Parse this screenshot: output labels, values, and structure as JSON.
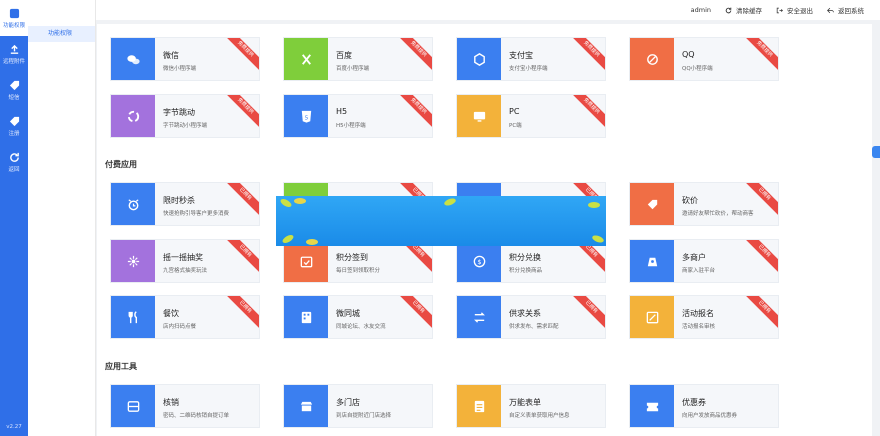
{
  "nav": {
    "items": [
      {
        "label": "功能权限",
        "icon": "grid-icon",
        "active": true
      },
      {
        "label": "远程附件",
        "icon": "upload-icon",
        "active": false
      },
      {
        "label": "短信",
        "icon": "tag-icon",
        "active": false
      },
      {
        "label": "注册",
        "icon": "tag-icon",
        "active": false
      },
      {
        "label": "返回",
        "icon": "refresh-icon",
        "active": false
      }
    ],
    "version": "v2.27"
  },
  "subnav": {
    "active_label": "功能权限"
  },
  "topbar": {
    "user": "admin",
    "clear_cache": "清除缓存",
    "logout": "安全退出",
    "back": "返回系统"
  },
  "sections": {
    "paid": "付费应用",
    "tools": "应用工具"
  },
  "ribbon_label": "免费提供",
  "colors": {
    "nav_bg": "#2f6fe8",
    "blue": "#3b7ff0",
    "green": "#7fce3b",
    "purple": "#a372dd",
    "orange": "#f3b23a",
    "red_orange": "#f06e45",
    "ribbon": "#e94a43"
  },
  "cards": [
    {
      "name": "微信",
      "desc": "微信小程序端",
      "color": "#3b7ff0",
      "icon": "wechat-icon",
      "ribbon": "免费提供"
    },
    {
      "name": "百度",
      "desc": "百度小程序端",
      "color": "#7fce3b",
      "icon": "baidu-icon",
      "ribbon": "免费提供"
    },
    {
      "name": "支付宝",
      "desc": "支付宝小程序端",
      "color": "#3b7ff0",
      "icon": "alipay-icon",
      "ribbon": "免费提供"
    },
    {
      "name": "QQ",
      "desc": "QQ小程序端",
      "color": "#f06e45",
      "icon": "qq-icon",
      "ribbon": "免费提供"
    },
    {
      "name": "字节跳动",
      "desc": "字节跳动小程序端",
      "color": "#a372dd",
      "icon": "bytedance-icon",
      "ribbon": "免费提供"
    },
    {
      "name": "H5",
      "desc": "H5小程序端",
      "color": "#3b7ff0",
      "icon": "h5-icon",
      "ribbon": "免费提供"
    },
    {
      "name": "PC",
      "desc": "PC端",
      "color": "#f3b23a",
      "icon": "pc-icon",
      "ribbon": "免费提供"
    },
    {
      "name": "限时秒杀",
      "desc": "快速抢购引导客户更多消费",
      "color": "#3b7ff0",
      "icon": "alarm-icon",
      "ribbon": "已拥有"
    },
    {
      "name": "",
      "desc": "",
      "color": "#7fce3b",
      "icon": "hidden-icon",
      "ribbon": "已拥有"
    },
    {
      "name": "",
      "desc": "",
      "color": "#3b7ff0",
      "icon": "hidden-icon",
      "ribbon": "已拥有"
    },
    {
      "name": "砍价",
      "desc": "邀请好友帮忙砍价，帮动商客",
      "color": "#f06e45",
      "icon": "bargain-icon",
      "ribbon": "已拥有"
    },
    {
      "name": "摇一摇抽奖",
      "desc": "九宫格式抽奖玩法",
      "color": "#a372dd",
      "icon": "lottery-icon",
      "ribbon": "已拥有"
    },
    {
      "name": "积分签到",
      "desc": "每日签到领取积分",
      "color": "#f06e45",
      "icon": "checkin-icon",
      "ribbon": "已拥有"
    },
    {
      "name": "积分兑换",
      "desc": "积分兑换商品",
      "color": "#3b7ff0",
      "icon": "exchange-icon",
      "ribbon": "已拥有"
    },
    {
      "name": "多商户",
      "desc": "商家入驻平台",
      "color": "#3b7ff0",
      "icon": "merchant-icon",
      "ribbon": "已拥有"
    },
    {
      "name": "餐饮",
      "desc": "店内扫码点餐",
      "color": "#3b7ff0",
      "icon": "dining-icon",
      "ribbon": "已拥有"
    },
    {
      "name": "微同城",
      "desc": "同城论坛、水友交流",
      "color": "#3b7ff0",
      "icon": "city-icon",
      "ribbon": "已拥有"
    },
    {
      "name": "供求关系",
      "desc": "供求发布、需求匹配",
      "color": "#3b7ff0",
      "icon": "supply-icon",
      "ribbon": "已拥有"
    },
    {
      "name": "活动报名",
      "desc": "活动报名审核",
      "color": "#f3b23a",
      "icon": "signup-icon",
      "ribbon": "已拥有"
    },
    {
      "name": "核销",
      "desc": "密码、二维码核销自提订单",
      "color": "#3b7ff0",
      "icon": "verify-icon",
      "ribbon": ""
    },
    {
      "name": "多门店",
      "desc": "到店自提附近门店选择",
      "color": "#3b7ff0",
      "icon": "store-icon",
      "ribbon": ""
    },
    {
      "name": "万能表单",
      "desc": "自定义表单获取用户信息",
      "color": "#f3b23a",
      "icon": "form-icon",
      "ribbon": ""
    },
    {
      "name": "优惠券",
      "desc": "向用户发放商品优惠券",
      "color": "#3b7ff0",
      "icon": "coupon-icon",
      "ribbon": ""
    }
  ]
}
